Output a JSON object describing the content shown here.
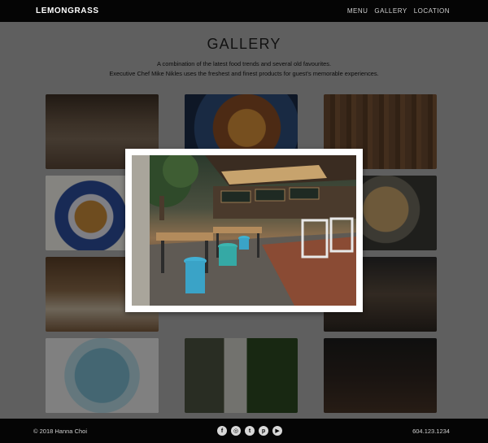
{
  "header": {
    "logo": "LEMONGRASS",
    "nav": [
      {
        "label": "MENU"
      },
      {
        "label": "GALLERY"
      },
      {
        "label": "LOCATION"
      }
    ]
  },
  "page": {
    "title": "GALLERY",
    "intro_line1": "A combination of the latest food trends and several old favourites.",
    "intro_line2": "Executive Chef Mike Nikles uses the freshest and finest products for guest's memorable experiences."
  },
  "gallery": {
    "tiles": [
      {
        "icon": "restaurant-photo"
      },
      {
        "icon": "salad-photo"
      },
      {
        "icon": "wood-interior-photo"
      },
      {
        "icon": "waffle-photo"
      },
      {
        "icon": "noodle-bowl-photo"
      },
      {
        "icon": "cafe-photo"
      },
      {
        "icon": "dining-table-photo"
      },
      {
        "icon": "bowl-photo"
      },
      {
        "icon": "garden-path-photo"
      },
      {
        "icon": "wine-glass-photo"
      }
    ],
    "featured": {
      "icon": "restaurant-interior-photo"
    }
  },
  "footer": {
    "copyright": "© 2018 Hanna Choi",
    "social": [
      {
        "icon": "facebook-icon",
        "glyph": "f"
      },
      {
        "icon": "instagram-icon",
        "glyph": "◎"
      },
      {
        "icon": "twitter-icon",
        "glyph": "t"
      },
      {
        "icon": "pinterest-icon",
        "glyph": "p"
      },
      {
        "icon": "youtube-icon",
        "glyph": "▶"
      }
    ],
    "phone": "604.123.1234"
  }
}
